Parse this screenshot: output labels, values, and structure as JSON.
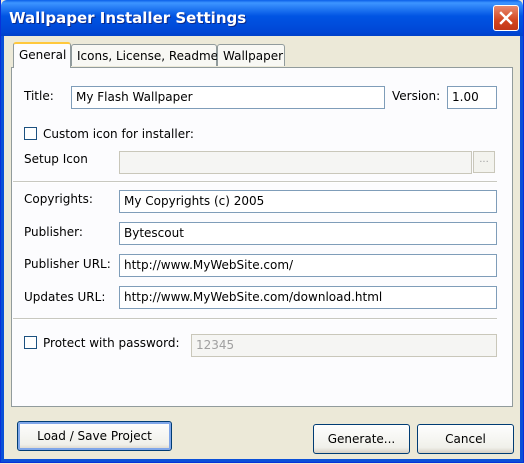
{
  "window": {
    "title": "Wallpaper Installer Settings"
  },
  "tabs": [
    {
      "label": "General",
      "active": true
    },
    {
      "label": "Icons, License, Readme",
      "active": false
    },
    {
      "label": "Wallpaper",
      "active": false
    }
  ],
  "general": {
    "title_label": "Title:",
    "title_value": "My Flash Wallpaper",
    "version_label": "Version:",
    "version_value": "1.00",
    "custom_icon_label": "Custom icon for installer:",
    "custom_icon_checked": false,
    "setup_icon_label": "Setup Icon",
    "setup_icon_value": "",
    "browse_label": "...",
    "copyrights_label": "Copyrights:",
    "copyrights_value": "My Copyrights (c) 2005",
    "publisher_label": "Publisher:",
    "publisher_value": "Bytescout",
    "publisher_url_label": "Publisher URL:",
    "publisher_url_value": "http://www.MyWebSite.com/",
    "updates_url_label": "Updates URL:",
    "updates_url_value": "http://www.MyWebSite.com/download.html",
    "protect_label": "Protect with password:",
    "protect_checked": false,
    "password_value": "12345"
  },
  "buttons": {
    "load_save": "Load / Save Project",
    "generate": "Generate...",
    "cancel": "Cancel"
  }
}
